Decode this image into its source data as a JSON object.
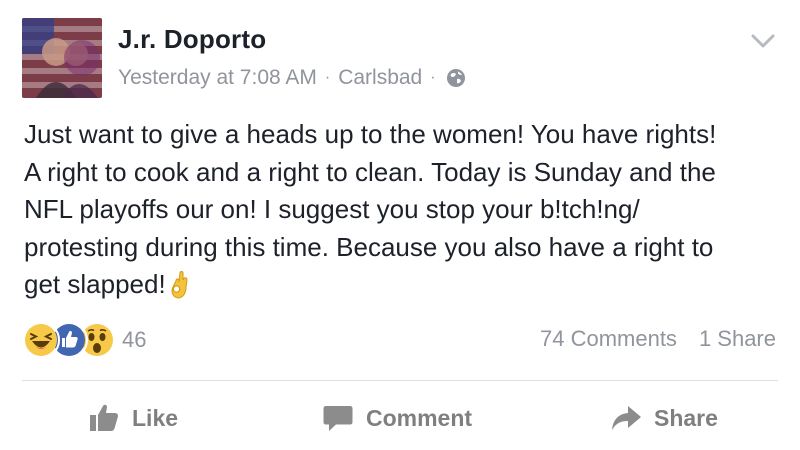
{
  "post": {
    "author": "J.r. Doporto",
    "timestamp": "Yesterday at 7:08 AM",
    "location": "Carlsbad",
    "separator": "·",
    "privacy_icon": "globe-icon",
    "options_icon": "chevron-down-icon",
    "text_lines": [
      "Just want to give a heads up to the women! You have rights!",
      "A right to cook and a right to clean. Today is Sunday and the",
      "NFL playoffs our on! I suggest you stop your b!tch!ng/",
      "protesting during this time. Because you also have a right to",
      "get slapped!"
    ],
    "trailing_emoji": "ok-hand-emoji"
  },
  "reactions": {
    "icons": [
      "laugh-reaction-icon",
      "like-reaction-icon",
      "wow-reaction-icon"
    ],
    "count": "46"
  },
  "stats": {
    "comments": "74 Comments",
    "shares": "1 Share"
  },
  "actions": {
    "like": "Like",
    "comment": "Comment",
    "share": "Share"
  },
  "colors": {
    "text": "#1d2129",
    "meta": "#90949c",
    "like_blue": "#4267b2",
    "reaction_yellow": "#f7c948",
    "action_gray": "#7f7f7f",
    "divider": "#dddfe2"
  }
}
